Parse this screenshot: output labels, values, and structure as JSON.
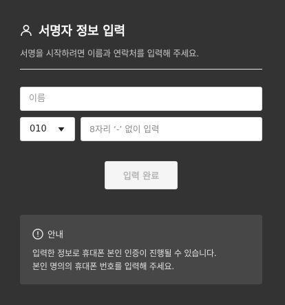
{
  "header": {
    "title": "서명자 정보 입력",
    "subtitle": "서명을 시작하려면 이름과 연락처를 입력해 주세요."
  },
  "form": {
    "name_placeholder": "이름",
    "phone_prefix": "010",
    "phone_placeholder": "8자리 ‘-’ 없이 입력",
    "submit_label": "입력 완료"
  },
  "notice": {
    "title": "안내",
    "line1": "입력한 정보로 휴대폰 본인 인증이 진행될 수 있습니다.",
    "line2": "본인 명의의 휴대폰 번호를 입력해 주세요."
  },
  "icons": {
    "title_icon": "user-icon",
    "prefix_caret": "caret-down-icon",
    "notice_icon": "info-icon"
  },
  "colors": {
    "background": "#333333",
    "notice_background": "#474747",
    "button_disabled_text": "#b5b5b5"
  }
}
